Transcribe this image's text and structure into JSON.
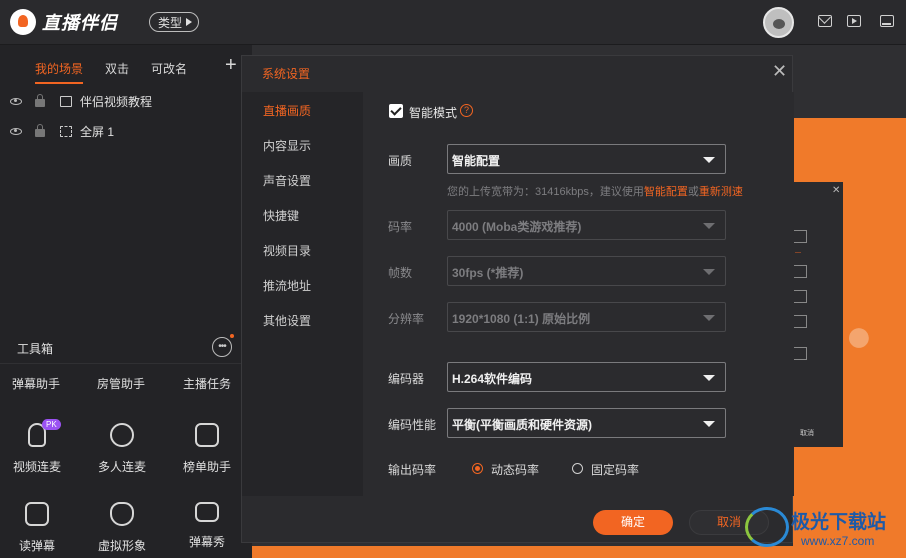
{
  "app": {
    "name": "直播伴侣",
    "type_label": "类型"
  },
  "scenes": {
    "tabs": [
      "我的场景",
      "双击",
      "可改名"
    ],
    "add_label": "+",
    "items": [
      {
        "label": "伴侣视频教程"
      },
      {
        "label": "全屏 1"
      }
    ]
  },
  "toolbox": {
    "title": "工具箱",
    "text_tools": [
      "弹幕助手",
      "房管助手",
      "主播任务"
    ],
    "row1": [
      {
        "label": "视频连麦",
        "icon": "mic-icon",
        "badge": "PK"
      },
      {
        "label": "多人连麦",
        "icon": "multi-mic-icon"
      },
      {
        "label": "榜单助手",
        "icon": "ranking-icon"
      }
    ],
    "row2": [
      {
        "label": "读弹幕",
        "icon": "read-danmu-icon"
      },
      {
        "label": "虚拟形象",
        "icon": "avatar-icon"
      },
      {
        "label": "弹幕秀",
        "icon": "tv-icon"
      }
    ]
  },
  "dialog": {
    "title": "系统设置",
    "nav": [
      "直播画质",
      "内容显示",
      "声音设置",
      "快捷键",
      "视频目录",
      "推流地址",
      "其他设置"
    ],
    "active_nav": "直播画质",
    "smart_mode": {
      "label": "智能模式",
      "checked": true,
      "help": "?"
    },
    "quality": {
      "label": "画质",
      "value": "智能配置"
    },
    "bandwidth_note": {
      "prefix": "您的上传宽带为：31416kbps，建议使用",
      "link1": "智能配置",
      "middle": "或",
      "link2": "重新测速"
    },
    "bitrate": {
      "label": "码率",
      "value": "4000 (Moba类游戏推荐)"
    },
    "fps": {
      "label": "帧数",
      "value": "30fps (*推荐)"
    },
    "resolution": {
      "label": "分辨率",
      "value": "1920*1080 (1:1) 原始比例"
    },
    "encoder": {
      "label": "编码器",
      "value": "H.264软件编码"
    },
    "encoder_perf": {
      "label": "编码性能",
      "value": "平衡(平衡画质和硬件资源)"
    },
    "output_bitrate": {
      "label": "输出码率",
      "options": [
        "动态码率",
        "固定码率"
      ],
      "selected": "动态码率"
    },
    "ok": "确定",
    "cancel": "取消"
  },
  "preview_overlay": {
    "cancel": "取消"
  },
  "watermark": {
    "title": "极光下载站",
    "url": "www.xz7.com"
  },
  "colors": {
    "accent": "#f26522",
    "bg": "#232326",
    "dialog": "#2b2b2e"
  }
}
